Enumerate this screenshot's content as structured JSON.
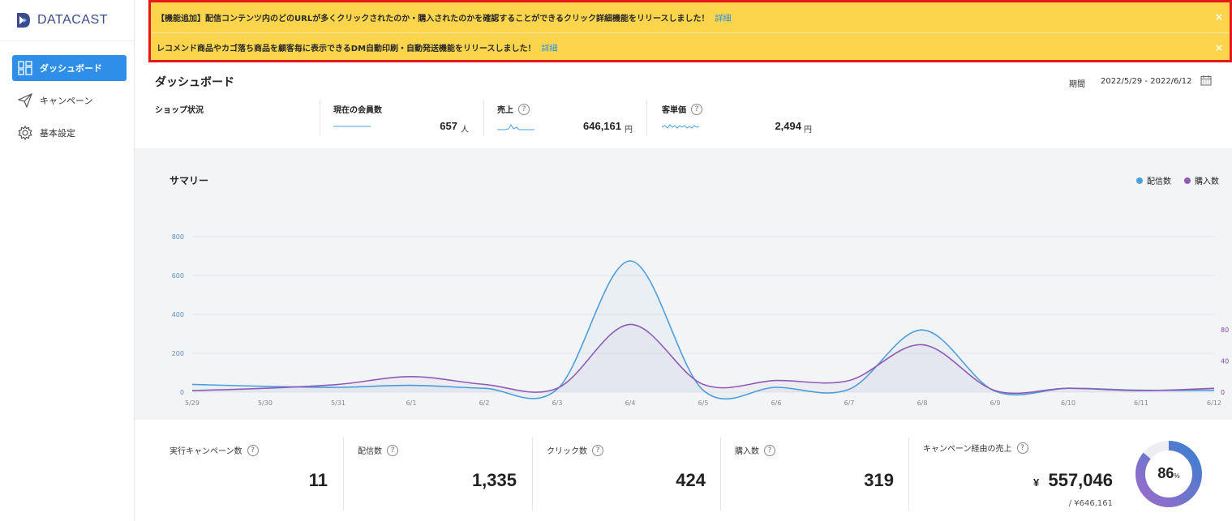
{
  "brand": {
    "name": "DATACAST"
  },
  "sidebar": {
    "items": [
      {
        "label": "ダッシュボード",
        "icon": "dashboard-icon",
        "active": true
      },
      {
        "label": "キャンペーン",
        "icon": "send-icon",
        "active": false
      },
      {
        "label": "基本設定",
        "icon": "gear-icon",
        "active": false
      }
    ]
  },
  "banner": {
    "notices": [
      {
        "text": "【機能追加】配信コンテンツ内のどのURLが多くクリックされたのか・購入されたのかを確認することができるクリック詳細機能をリリースしました！",
        "link": "詳細",
        "close": "×"
      },
      {
        "text": "レコメンド商品やカゴ落ち商品を顧客毎に表示できるDM自動印刷・自動発送機能をリリースしました！",
        "link": "詳細",
        "close": "×"
      }
    ]
  },
  "header": {
    "title": "ダッシュボード",
    "period_label": "期間",
    "period_value": "2022/5/29 - 2022/6/12"
  },
  "shop": {
    "label": "ショップ状況",
    "kpis": [
      {
        "label": "現在の会員数",
        "value": "657",
        "unit": "人",
        "help": false
      },
      {
        "label": "売上",
        "value": "646,161",
        "unit": "円",
        "help": true,
        "help_icon": "?"
      },
      {
        "label": "客単価",
        "value": "2,494",
        "unit": "円",
        "help": true,
        "help_icon": "?"
      }
    ]
  },
  "summary": {
    "title": "サマリー",
    "legend": [
      {
        "label": "配信数",
        "color": "#4c9fdc"
      },
      {
        "label": "購入数",
        "color": "#8e5cb5"
      }
    ]
  },
  "chart_data": {
    "type": "line",
    "categories": [
      "5/29",
      "5/30",
      "5/31",
      "6/1",
      "6/2",
      "6/3",
      "6/4",
      "6/5",
      "6/6",
      "6/7",
      "6/8",
      "6/9",
      "6/10",
      "6/11",
      "6/12"
    ],
    "series": [
      {
        "name": "配信数",
        "axis": "left",
        "color": "#4c9fdc",
        "values": [
          40,
          30,
          25,
          35,
          20,
          15,
          675,
          10,
          25,
          15,
          320,
          5,
          20,
          10,
          10
        ]
      },
      {
        "name": "購入数",
        "axis": "right",
        "color": "#8e5cb5",
        "values": [
          2,
          5,
          10,
          20,
          10,
          5,
          87,
          10,
          15,
          15,
          61,
          2,
          5,
          2,
          5
        ]
      }
    ],
    "y_left": {
      "ticks": [
        0,
        200,
        400,
        600,
        800
      ],
      "ylim": [
        0,
        800
      ],
      "color": "#5b8fc7"
    },
    "y_right": {
      "ticks": [
        0,
        40,
        80
      ],
      "ylim": [
        0,
        200
      ],
      "color": "#8e44ad"
    },
    "grid": true,
    "legend_position": "top-right"
  },
  "stats": [
    {
      "label": "実行キャンペーン数",
      "value": "11",
      "help_icon": "?"
    },
    {
      "label": "配信数",
      "value": "1,335",
      "help_icon": "?"
    },
    {
      "label": "クリック数",
      "value": "424",
      "help_icon": "?"
    },
    {
      "label": "購入数",
      "value": "319",
      "help_icon": "?"
    }
  ],
  "campaign_sales": {
    "label": "キャンペーン経由の売上",
    "help_icon": "?",
    "currency": "¥",
    "value": "557,046",
    "total": "/ ¥646,161",
    "ratio_percent": 86,
    "ratio_text": "86",
    "ratio_unit": "%"
  }
}
